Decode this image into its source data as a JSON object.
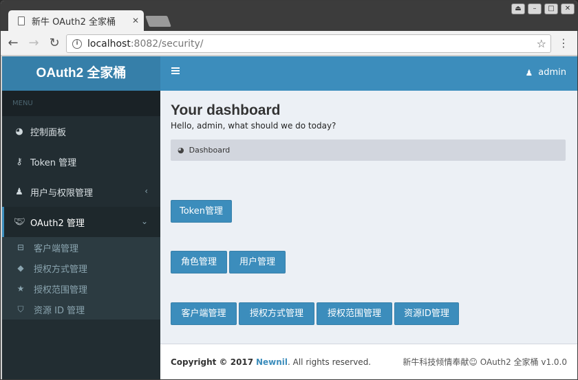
{
  "browser": {
    "tab_title": "新牛 OAuth2 全家桶",
    "url_host": "localhost",
    "url_path": ":8082/security/"
  },
  "sidebar": {
    "brand": "OAuth2 全家桶",
    "menu_header": "MENU",
    "items": [
      {
        "label": "控制面板",
        "icon": "dashboard-icon"
      },
      {
        "label": "Token 管理",
        "icon": "key-icon"
      },
      {
        "label": "用户与权限管理",
        "icon": "user-icon"
      },
      {
        "label": "OAuth2 管理",
        "icon": "handshake-icon"
      }
    ],
    "sub_items": [
      {
        "label": "客户端管理",
        "icon": "drive-icon"
      },
      {
        "label": "授权方式管理",
        "icon": "tags-icon"
      },
      {
        "label": "授权范围管理",
        "icon": "star-icon"
      },
      {
        "label": "资源 ID 管理",
        "icon": "shield-icon"
      }
    ]
  },
  "topbar": {
    "user": "admin"
  },
  "main": {
    "title": "Your dashboard",
    "subtitle": "Hello, admin, what should we do today?",
    "breadcrumb": "Dashboard",
    "buttons": {
      "token": "Token管理",
      "role": "角色管理",
      "user": "用户管理",
      "client": "客户端管理",
      "grant": "授权方式管理",
      "scope": "授权范围管理",
      "resource": "资源ID管理"
    }
  },
  "footer": {
    "copyright_prefix": "Copyright © 2017",
    "company": "Newnil",
    "rights": ". All rights reserved.",
    "right_text": "新牛科技倾情奉献☺ OAuth2 全家桶 v1.0.0"
  }
}
